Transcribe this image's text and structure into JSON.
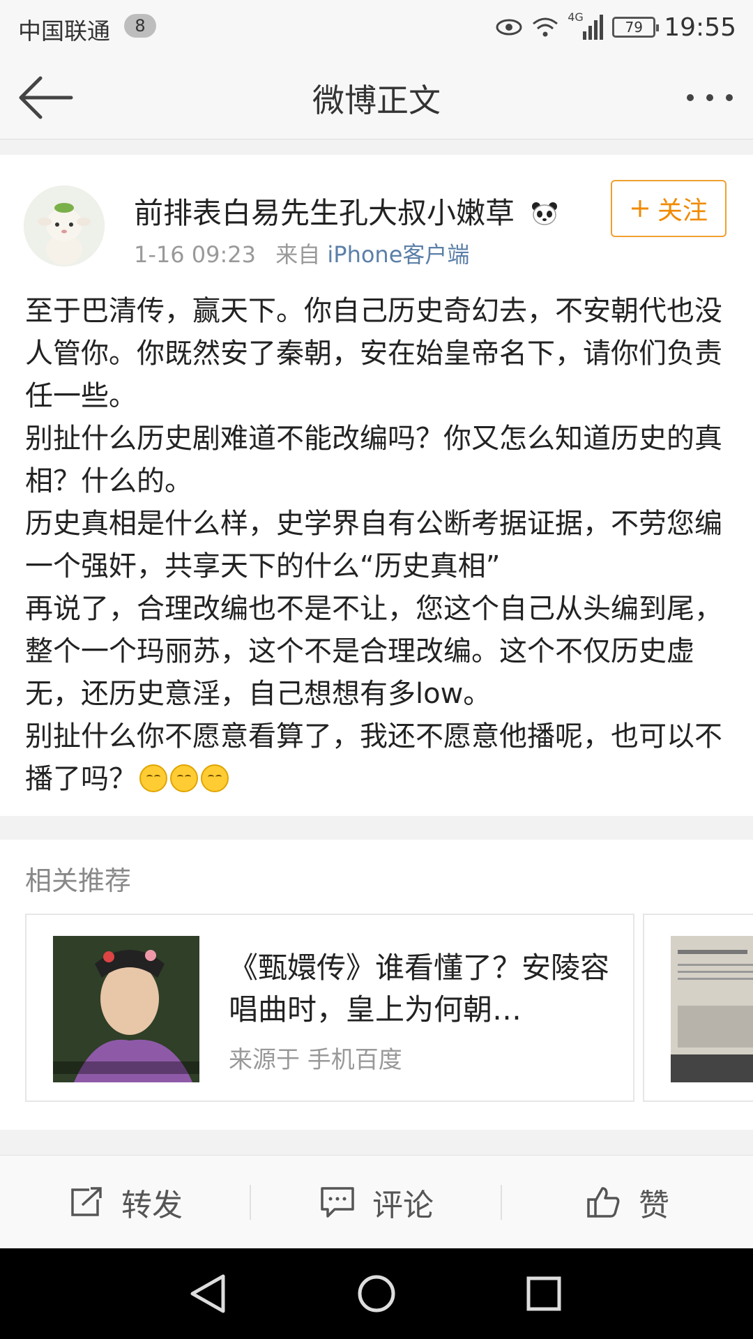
{
  "status_bar": {
    "carrier": "中国联通",
    "notification_count": "8",
    "network": "4G",
    "battery": "79",
    "time": "19:55"
  },
  "header": {
    "title": "微博正文"
  },
  "post": {
    "username": "前排表白易先生孔大叔小嫩草",
    "time": "1-16 09:23",
    "source_prefix": "来自",
    "source": "iPhone客户端",
    "follow_label": "关注",
    "paragraphs": [
      "至于巴清传，赢天下。你自己历史奇幻去，不安朝代也没人管你。你既然安了秦朝，安在始皇帝名下，请你们负责任一些。",
      "别扯什么历史剧难道不能改编吗？你又怎么知道历史的真相？什么的。",
      "历史真相是什么样，史学界自有公断考据证据，不劳您编一个强奸，共享天下的什么“历史真相”",
      "再说了，合理改编也不是不让，您这个自己从头编到尾，整个一个玛丽苏，这个不是合理改编。这个不仅历史虚无，还历史意淫，自己想想有多low。",
      "别扯什么你不愿意看算了，我还不愿意他播呢，也可以不播了吗？"
    ]
  },
  "related": {
    "title": "相关推荐",
    "items": [
      {
        "title": "《甄嬛传》谁看懂了？安陵容唱曲时，皇上为何朝…",
        "source": "来源于 手机百度"
      }
    ]
  },
  "actions": {
    "repost": "转发",
    "comment": "评论",
    "like": "赞"
  },
  "colors": {
    "accent": "#f08a00",
    "link": "#5b7fa8"
  }
}
